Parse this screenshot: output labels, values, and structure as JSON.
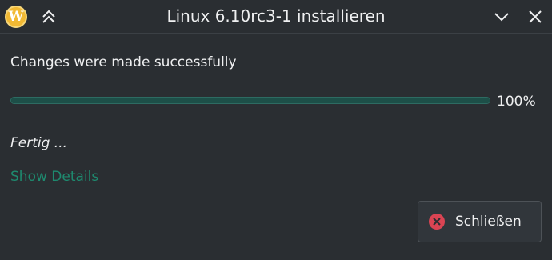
{
  "window": {
    "title": "Linux 6.10rc3-1 installieren",
    "logo_letter": "W",
    "icons": {
      "logo": "app-logo-icon",
      "keep_above": "chevron-double-up-icon",
      "minimize": "chevron-down-icon",
      "close": "close-icon"
    }
  },
  "main": {
    "status_message": "Changes were made successfully",
    "progress": {
      "value": 100,
      "label": "100%"
    },
    "step_text": "Fertig ...",
    "details_link": "Show Details"
  },
  "footer": {
    "close_button_label": "Schließen",
    "close_button_icon": "dialog-close-icon"
  },
  "colors": {
    "background": "#2a2e32",
    "text": "#eff0f1",
    "accent": "#1e8a6f",
    "progress_fill": "#1d4f48",
    "close_icon_red": "#da4453"
  }
}
